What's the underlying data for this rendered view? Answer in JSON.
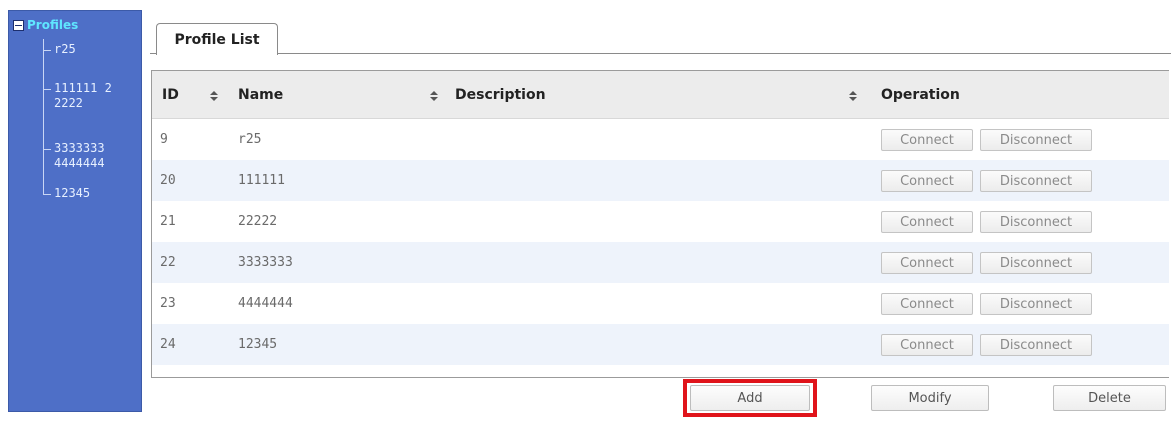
{
  "tree": {
    "root_label": "Profiles",
    "items": [
      {
        "label": "r25"
      },
      {
        "label": "111111 22222"
      },
      {
        "label": "3333333 4444444"
      },
      {
        "label": "12345"
      }
    ]
  },
  "tab": {
    "label": "Profile List"
  },
  "table": {
    "columns": {
      "id": "ID",
      "name": "Name",
      "description": "Description",
      "operation": "Operation"
    },
    "rows": [
      {
        "id": "9",
        "name": "r25",
        "description": "",
        "connect": "Connect",
        "disconnect": "Disconnect"
      },
      {
        "id": "20",
        "name": "111111",
        "description": "",
        "connect": "Connect",
        "disconnect": "Disconnect"
      },
      {
        "id": "21",
        "name": "22222",
        "description": "",
        "connect": "Connect",
        "disconnect": "Disconnect"
      },
      {
        "id": "22",
        "name": "3333333",
        "description": "",
        "connect": "Connect",
        "disconnect": "Disconnect"
      },
      {
        "id": "23",
        "name": "4444444",
        "description": "",
        "connect": "Connect",
        "disconnect": "Disconnect"
      },
      {
        "id": "24",
        "name": "12345",
        "description": "",
        "connect": "Connect",
        "disconnect": "Disconnect"
      }
    ]
  },
  "actions": {
    "add": "Add",
    "modify": "Modify",
    "delete": "Delete"
  },
  "colors": {
    "tree_background": "#4e6fc7",
    "tree_root_text": "#5fe6ff",
    "highlight": "#e0141b",
    "row_alt": "#eef3fb"
  },
  "icons": {
    "tree_toggle": "minus-box-icon",
    "sort": "sort-arrows-icon"
  }
}
